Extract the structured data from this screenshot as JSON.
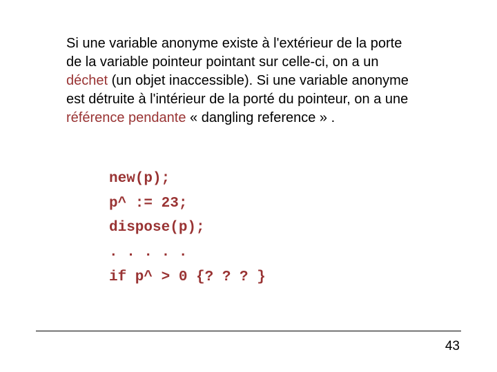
{
  "paragraph": {
    "pre1": "Si une variable anonyme existe à l'extérieur de la porte de la variable pointeur pointant sur celle-ci, on a un ",
    "term1": "déchet",
    "mid": " (un objet inaccessible). Si une variable anonyme est détruite à l'intérieur de la porté du pointeur, on a une ",
    "term2": "référence pendante",
    "post": " « dangling reference » ."
  },
  "code": {
    "l1": "new(p);",
    "l2": "p^ := 23;",
    "l3": "dispose(p);",
    "l4": ". . . . .",
    "l5": "if p^ > 0 {? ? ? }"
  },
  "page_number": "43"
}
